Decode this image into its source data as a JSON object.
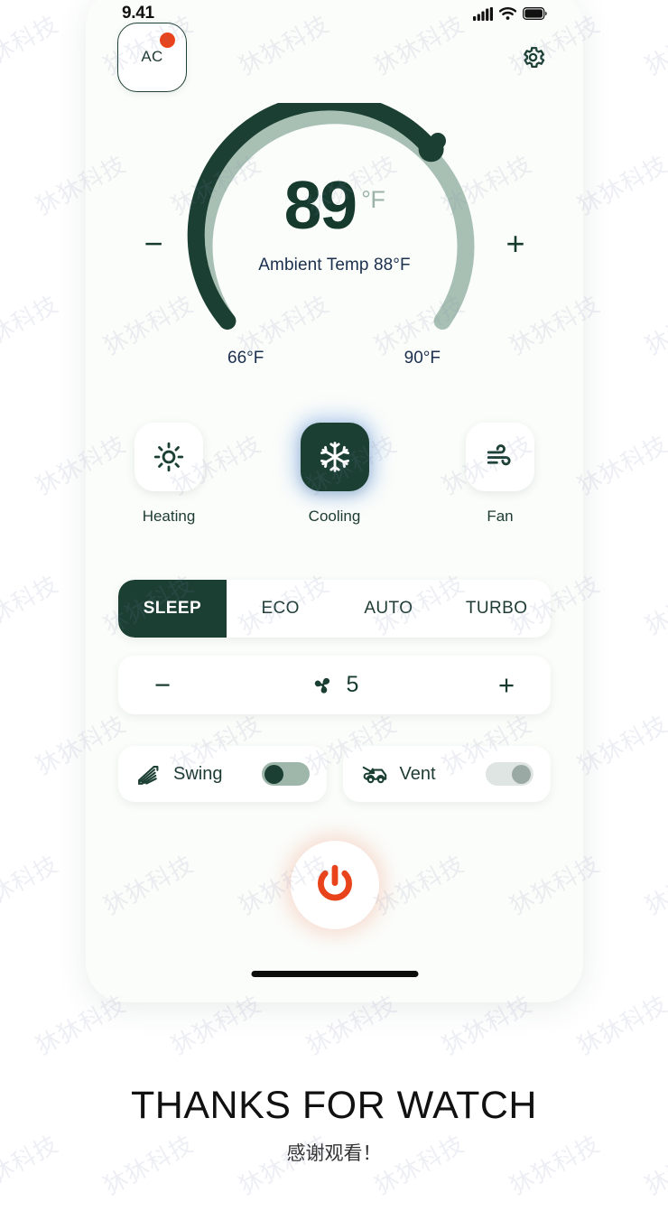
{
  "status_bar": {
    "time": "9.41",
    "signal_icon": "signal-bars-icon",
    "wifi_icon": "wifi-icon",
    "battery_icon": "battery-full-icon"
  },
  "top_bar": {
    "device_label": "AC",
    "device_badge": "active-dot",
    "settings_icon": "gear-icon"
  },
  "dial": {
    "target_temp": "89",
    "unit": "°F",
    "ambient_label": "Ambient Temp 88°F",
    "range_min": "66°F",
    "range_max": "90°F",
    "decrease_label": "−",
    "increase_label": "+",
    "track_color": "#a8c0b4",
    "progress_color": "#1b3f32"
  },
  "modes": [
    {
      "label": "Heating",
      "icon": "sun-icon",
      "active": false
    },
    {
      "label": "Cooling",
      "icon": "snowflake-icon",
      "active": true
    },
    {
      "label": "Fan",
      "icon": "wind-icon",
      "active": false
    }
  ],
  "presets": [
    {
      "label": "SLEEP",
      "active": true
    },
    {
      "label": "ECO",
      "active": false
    },
    {
      "label": "AUTO",
      "active": false
    },
    {
      "label": "TURBO",
      "active": false
    }
  ],
  "fan_speed": {
    "decrease_label": "−",
    "increase_label": "+",
    "value": "5",
    "icon": "fan-blade-icon"
  },
  "toggles": [
    {
      "label": "Swing",
      "icon": "swing-louver-icon",
      "state": "on"
    },
    {
      "label": "Vent",
      "icon": "car-vent-icon",
      "state": "off"
    }
  ],
  "power_button": {
    "icon": "power-icon",
    "color": "#e8431a"
  },
  "footer": {
    "title": "THANKS FOR WATCH",
    "subtitle": "感谢观看！"
  },
  "watermark": {
    "text": "狇狇科技"
  },
  "theme": {
    "dark_green": "#1b3f32",
    "screen_bg": "#fbfdfa",
    "accent_red": "#e8431a",
    "glow_blue": "#6ea0eb"
  }
}
